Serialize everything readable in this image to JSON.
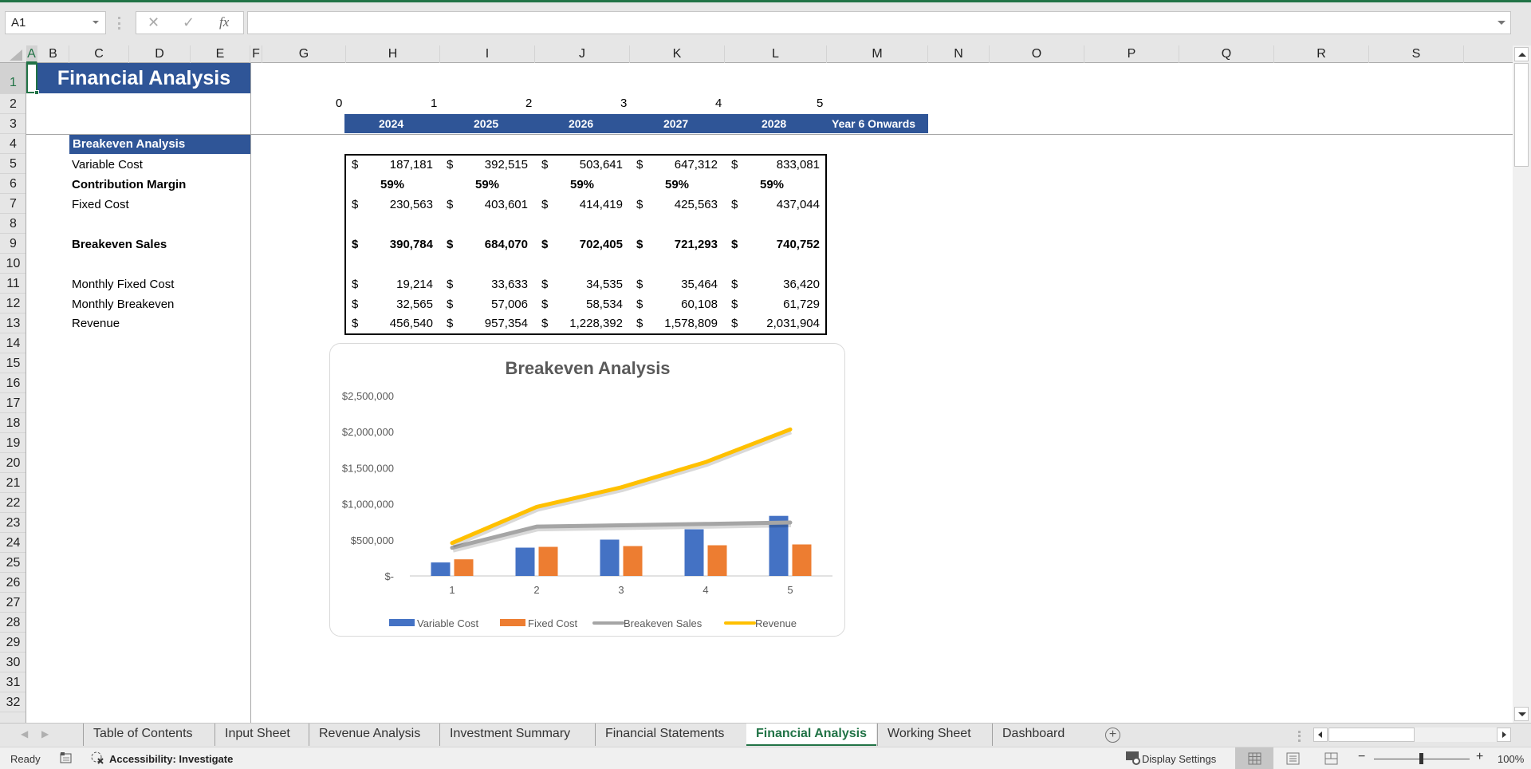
{
  "formula_bar": {
    "name_box": "A1",
    "cancel_icon": "✕",
    "enter_icon": "✓",
    "fx_label": "fx",
    "formula_value": ""
  },
  "columns": [
    "A",
    "B",
    "C",
    "D",
    "E",
    "F",
    "G",
    "H",
    "I",
    "J",
    "K",
    "L",
    "M",
    "N",
    "O",
    "P",
    "Q",
    "R",
    "S"
  ],
  "selected_column": "A",
  "rows": [
    "1",
    "2",
    "3",
    "4",
    "5",
    "6",
    "7",
    "8",
    "9",
    "10",
    "11",
    "12",
    "13",
    "14",
    "15",
    "16",
    "17",
    "18",
    "19",
    "20",
    "21",
    "22",
    "23",
    "24",
    "25",
    "26",
    "27",
    "28",
    "29",
    "30",
    "31",
    "32"
  ],
  "sheet": {
    "title": "Financial Analysis",
    "period_indices": [
      "0",
      "1",
      "2",
      "3",
      "4",
      "5"
    ],
    "years": [
      "2024",
      "2025",
      "2026",
      "2027",
      "2028",
      "Year 6 Onwards"
    ],
    "section_header": "Breakeven Analysis",
    "labels": {
      "variable_cost": "Variable Cost",
      "contribution_margin": "Contribution Margin",
      "fixed_cost": "Fixed Cost",
      "breakeven_sales": "Breakeven Sales",
      "monthly_fixed_cost": "Monthly Fixed Cost",
      "monthly_breakeven": "Monthly Breakeven",
      "revenue": "Revenue"
    },
    "currency_symbol": "$",
    "table": {
      "variable_cost": [
        "187,181",
        "392,515",
        "503,641",
        "647,312",
        "833,081"
      ],
      "contribution_margin": [
        "59%",
        "59%",
        "59%",
        "59%",
        "59%"
      ],
      "fixed_cost": [
        "230,563",
        "403,601",
        "414,419",
        "425,563",
        "437,044"
      ],
      "breakeven_sales": [
        "390,784",
        "684,070",
        "702,405",
        "721,293",
        "740,752"
      ],
      "monthly_fixed_cost": [
        "19,214",
        "33,633",
        "34,535",
        "35,464",
        "36,420"
      ],
      "monthly_breakeven": [
        "32,565",
        "57,006",
        "58,534",
        "60,108",
        "61,729"
      ],
      "revenue": [
        "456,540",
        "957,354",
        "1,228,392",
        "1,578,809",
        "2,031,904"
      ]
    }
  },
  "chart_data": {
    "type": "bar",
    "title": "Breakeven Analysis",
    "categories": [
      "1",
      "2",
      "3",
      "4",
      "5"
    ],
    "xlabel": "",
    "ylabel": "",
    "ylim": [
      0,
      2500000
    ],
    "yticks": [
      0,
      500000,
      1000000,
      1500000,
      2000000,
      2500000
    ],
    "ytick_labels": [
      "$-",
      "$500,000",
      "$1,000,000",
      "$1,500,000",
      "$2,000,000",
      "$2,500,000"
    ],
    "grid": false,
    "legend": "bottom",
    "series": [
      {
        "name": "Variable Cost",
        "kind": "bar",
        "color": "#4472c4",
        "values": [
          187181,
          392515,
          503641,
          647312,
          833081
        ]
      },
      {
        "name": "Fixed Cost",
        "kind": "bar",
        "color": "#ed7d31",
        "values": [
          230563,
          403601,
          414419,
          425563,
          437044
        ]
      },
      {
        "name": "Breakeven Sales",
        "kind": "line",
        "color": "#a5a5a5",
        "values": [
          390784,
          684070,
          702405,
          721293,
          740752
        ]
      },
      {
        "name": "Revenue",
        "kind": "line",
        "color": "#ffc000",
        "values": [
          456540,
          957354,
          1228392,
          1578809,
          2031904
        ]
      }
    ]
  },
  "tabs": [
    {
      "label": "Table of Contents",
      "active": false
    },
    {
      "label": "Input Sheet",
      "active": false
    },
    {
      "label": "Revenue Analysis",
      "active": false
    },
    {
      "label": "Investment Summary",
      "active": false
    },
    {
      "label": "Financial Statements",
      "active": false
    },
    {
      "label": "Financial Analysis",
      "active": true
    },
    {
      "label": "Working Sheet",
      "active": false
    },
    {
      "label": "Dashboard",
      "active": false
    }
  ],
  "add_sheet_icon": "+",
  "status": {
    "ready": "Ready",
    "accessibility": "Accessibility: Investigate",
    "display_settings": "Display Settings",
    "zoom_minus": "−",
    "zoom_plus": "+",
    "zoom_level": "100%"
  },
  "colors": {
    "accent": "#217346",
    "header_blue": "#2f5597"
  }
}
